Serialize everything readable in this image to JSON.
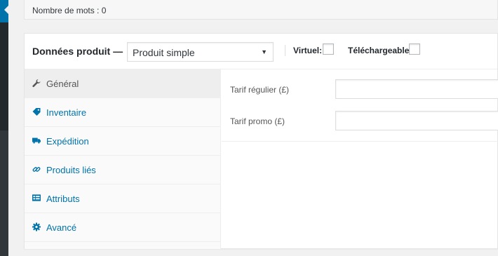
{
  "wordcount": {
    "text": "Nombre de mots : 0"
  },
  "product_data": {
    "title": "Données produit —",
    "product_type": {
      "selected": "Produit simple"
    },
    "virtual_label": "Virtuel:",
    "downloadable_label": "Téléchargeable:",
    "tabs": [
      {
        "label": "Général",
        "icon": "wrench-icon",
        "active": true
      },
      {
        "label": "Inventaire",
        "icon": "tag-icon",
        "active": false
      },
      {
        "label": "Expédition",
        "icon": "truck-icon",
        "active": false
      },
      {
        "label": "Produits liés",
        "icon": "link-icon",
        "active": false
      },
      {
        "label": "Attributs",
        "icon": "table-icon",
        "active": false
      },
      {
        "label": "Avancé",
        "icon": "gear-icon",
        "active": false
      }
    ],
    "general": {
      "regular_price_label": "Tarif régulier (£)",
      "regular_price_value": "",
      "sale_price_label": "Tarif promo (£)",
      "sale_price_value": ""
    }
  },
  "colors": {
    "accent": "#0073aa",
    "admin_menu": "#23282d"
  }
}
